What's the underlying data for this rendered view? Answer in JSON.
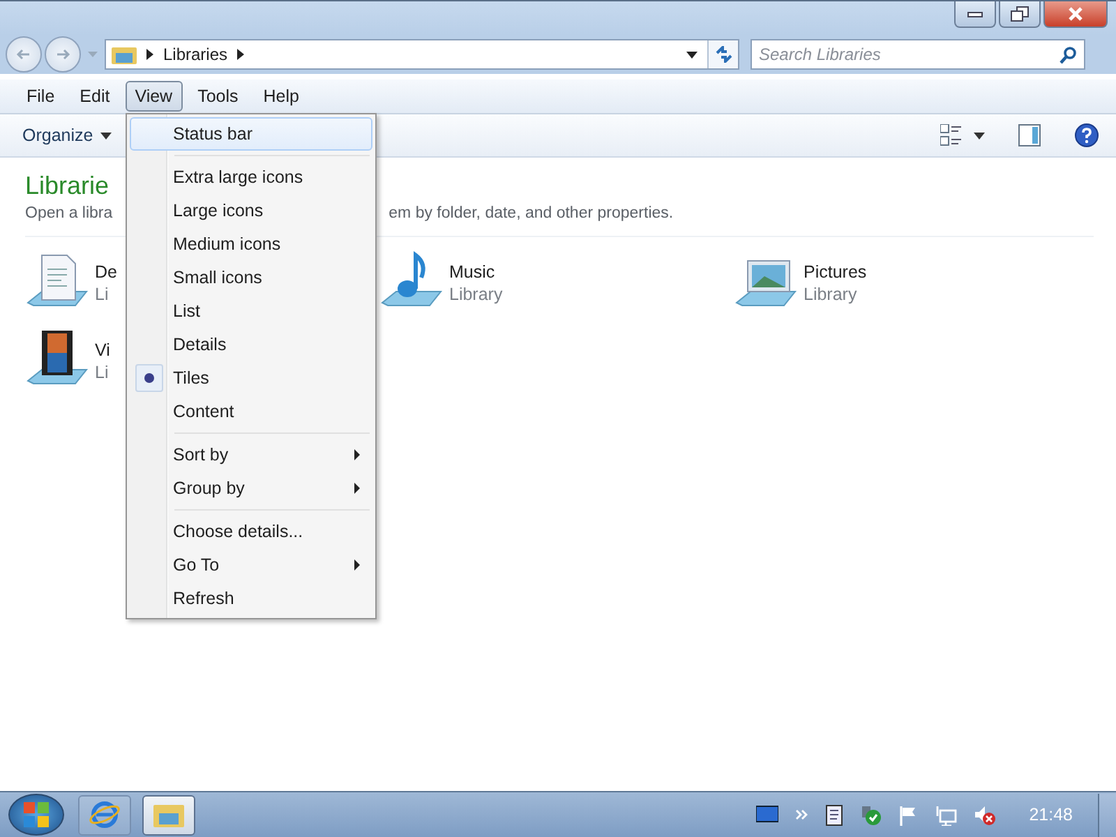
{
  "address_bar": {
    "crumbs": [
      "Libraries"
    ]
  },
  "search": {
    "placeholder": "Search Libraries"
  },
  "menu_bar": [
    {
      "label": "File",
      "selected": false
    },
    {
      "label": "Edit",
      "selected": false
    },
    {
      "label": "View",
      "selected": true
    },
    {
      "label": "Tools",
      "selected": false
    },
    {
      "label": "Help",
      "selected": false
    }
  ],
  "command_bar": {
    "organize": "Organize"
  },
  "content": {
    "title": "Librarie",
    "description_left": "Open a libra",
    "description_right": "em by folder, date, and other properties.",
    "tiles": [
      {
        "kind": "documents",
        "name": "De",
        "subtitle": "Li"
      },
      {
        "kind": "music",
        "name": "Music",
        "subtitle": "Library"
      },
      {
        "kind": "pictures",
        "name": "Pictures",
        "subtitle": "Library"
      },
      {
        "kind": "videos",
        "name": "Vi",
        "subtitle": "Li"
      }
    ]
  },
  "view_menu": {
    "groups": [
      [
        {
          "label": "Status bar",
          "hovered": true,
          "selected": false,
          "submenu": false
        }
      ],
      [
        {
          "label": "Extra large icons",
          "hovered": false,
          "selected": false,
          "submenu": false
        },
        {
          "label": "Large icons",
          "hovered": false,
          "selected": false,
          "submenu": false
        },
        {
          "label": "Medium icons",
          "hovered": false,
          "selected": false,
          "submenu": false
        },
        {
          "label": "Small icons",
          "hovered": false,
          "selected": false,
          "submenu": false
        },
        {
          "label": "List",
          "hovered": false,
          "selected": false,
          "submenu": false
        },
        {
          "label": "Details",
          "hovered": false,
          "selected": false,
          "submenu": false
        },
        {
          "label": "Tiles",
          "hovered": false,
          "selected": true,
          "submenu": false
        },
        {
          "label": "Content",
          "hovered": false,
          "selected": false,
          "submenu": false
        }
      ],
      [
        {
          "label": "Sort by",
          "hovered": false,
          "selected": false,
          "submenu": true
        },
        {
          "label": "Group by",
          "hovered": false,
          "selected": false,
          "submenu": true
        }
      ],
      [
        {
          "label": "Choose details...",
          "hovered": false,
          "selected": false,
          "submenu": false
        },
        {
          "label": "Go To",
          "hovered": false,
          "selected": false,
          "submenu": true
        },
        {
          "label": "Refresh",
          "hovered": false,
          "selected": false,
          "submenu": false
        }
      ]
    ]
  },
  "taskbar": {
    "apps": [
      {
        "kind": "browser",
        "active": false
      },
      {
        "kind": "explorer",
        "active": true
      }
    ],
    "clock": "21:48"
  }
}
